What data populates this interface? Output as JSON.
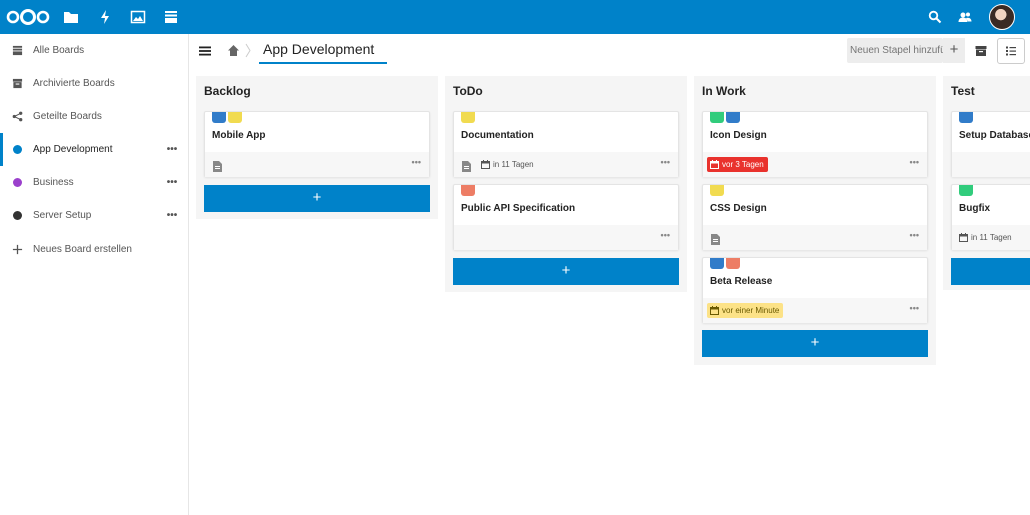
{
  "header": {
    "apps": [
      {
        "name": "files-app-icon",
        "icon": "folder"
      },
      {
        "name": "activity-app-icon",
        "icon": "lightning"
      },
      {
        "name": "gallery-app-icon",
        "icon": "image"
      },
      {
        "name": "deck-app-icon",
        "icon": "deck"
      }
    ],
    "right_icons": [
      "search-icon",
      "contacts-icon",
      "user-avatar"
    ]
  },
  "sidebar": {
    "items": [
      {
        "label": "Alle Boards",
        "icon": "deck-icon",
        "active": false,
        "more": ""
      },
      {
        "label": "Archivierte Boards",
        "icon": "archive-icon",
        "active": false,
        "more": ""
      },
      {
        "label": "Geteilte Boards",
        "icon": "share-icon",
        "active": false,
        "more": ""
      },
      {
        "label": "App Development",
        "icon": "dot",
        "color": "#0082c9",
        "active": true,
        "more": "•••"
      },
      {
        "label": "Business",
        "icon": "dot",
        "color": "#9b40cc",
        "active": false,
        "more": "•••"
      },
      {
        "label": "Server Setup",
        "icon": "dot",
        "color": "#333333",
        "active": false,
        "more": "•••"
      },
      {
        "label": "Neues Board erstellen",
        "icon": "plus-icon",
        "active": false,
        "more": ""
      }
    ]
  },
  "board": {
    "title": "App Development",
    "new_stack_placeholder": "Neuen Stapel hinzufügen",
    "new_stack_button": "+"
  },
  "stacks": [
    {
      "title": "Backlog",
      "cards": [
        {
          "title": "Mobile App",
          "labels": [
            "#317cc9",
            "#f1db50"
          ],
          "has_description": true,
          "due": null,
          "more": "•••"
        }
      ],
      "add_label": "+"
    },
    {
      "title": "ToDo",
      "cards": [
        {
          "title": "Documentation",
          "labels": [
            "#f1db50"
          ],
          "has_description": true,
          "due": {
            "text": "in 11 Tagen",
            "style": "plain"
          },
          "more": "•••"
        },
        {
          "title": "Public API Specification",
          "labels": [
            "#ed7d65"
          ],
          "has_description": false,
          "due": null,
          "more": "•••"
        }
      ],
      "add_label": "+"
    },
    {
      "title": "In Work",
      "cards": [
        {
          "title": "Icon Design",
          "labels": [
            "#31cc7c",
            "#317cc9"
          ],
          "has_description": false,
          "due": {
            "text": "vor 3 Tagen",
            "style": "overdue"
          },
          "more": "•••"
        },
        {
          "title": "CSS Design",
          "labels": [
            "#f1db50"
          ],
          "has_description": true,
          "due": null,
          "more": "•••"
        },
        {
          "title": "Beta Release",
          "labels": [
            "#317cc9",
            "#ed7d65"
          ],
          "has_description": false,
          "due": {
            "text": "vor einer Minute",
            "style": "now"
          },
          "more": "•••"
        }
      ],
      "add_label": "+"
    },
    {
      "title": "Test",
      "cards": [
        {
          "title": "Setup Database",
          "labels": [
            "#317cc9"
          ],
          "has_description": false,
          "due": null,
          "more": ""
        },
        {
          "title": "Bugfix",
          "labels": [
            "#31cc7c"
          ],
          "has_description": false,
          "due": {
            "text": "in 11 Tagen",
            "style": "plain"
          },
          "more": ""
        }
      ],
      "add_label": "+"
    }
  ],
  "colors": {
    "accent": "#0082c9",
    "overdue_bg": "#e9322d",
    "now_bg": "#fce287"
  }
}
